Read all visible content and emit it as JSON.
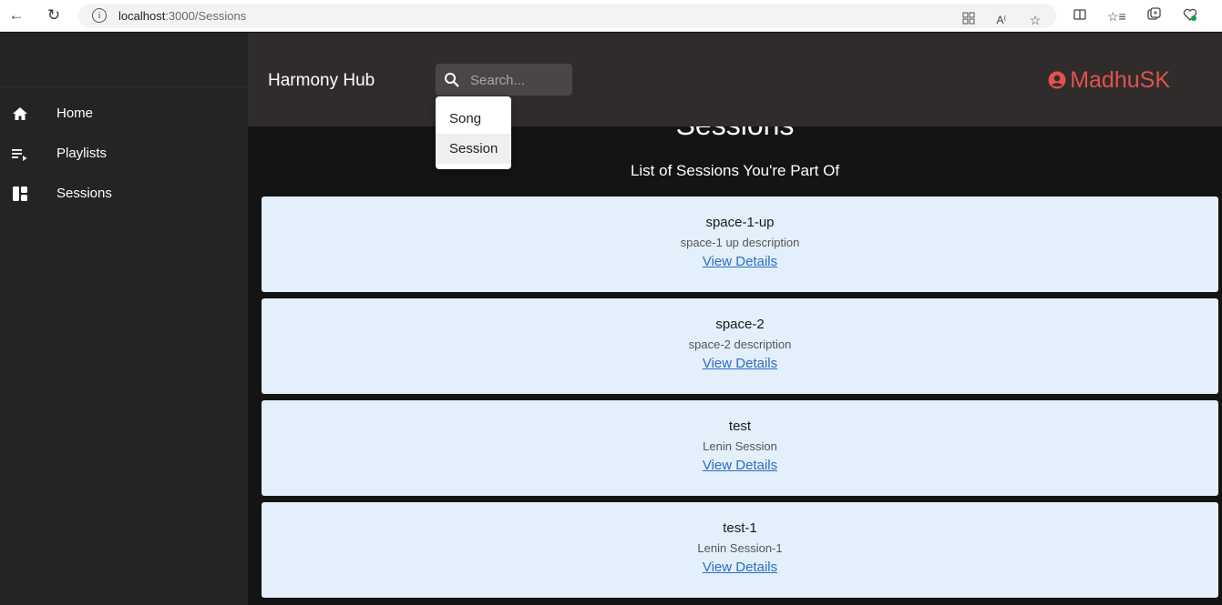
{
  "browser": {
    "url_host": "localhost",
    "url_path": ":3000/Sessions"
  },
  "sidebar": {
    "items": [
      {
        "label": "Home",
        "icon": "home-icon"
      },
      {
        "label": "Playlists",
        "icon": "playlist-icon"
      },
      {
        "label": "Sessions",
        "icon": "dashboard-icon"
      }
    ]
  },
  "header": {
    "brand": "Harmony Hub",
    "search_placeholder": "Search...",
    "username": "MadhuSK",
    "username_color": "#e0524c"
  },
  "search_dropdown": {
    "options": [
      "Song",
      "Session"
    ],
    "selected": "Session"
  },
  "main": {
    "title": "Sessions",
    "subtitle": "List of Sessions You're Part Of",
    "sessions": [
      {
        "name": "space-1-up",
        "description": "space-1 up description",
        "link": "View Details"
      },
      {
        "name": "space-2",
        "description": "space-2 description",
        "link": "View Details"
      },
      {
        "name": "test",
        "description": "Lenin Session",
        "link": "View Details"
      },
      {
        "name": "test-1",
        "description": "Lenin Session-1",
        "link": "View Details"
      }
    ]
  }
}
